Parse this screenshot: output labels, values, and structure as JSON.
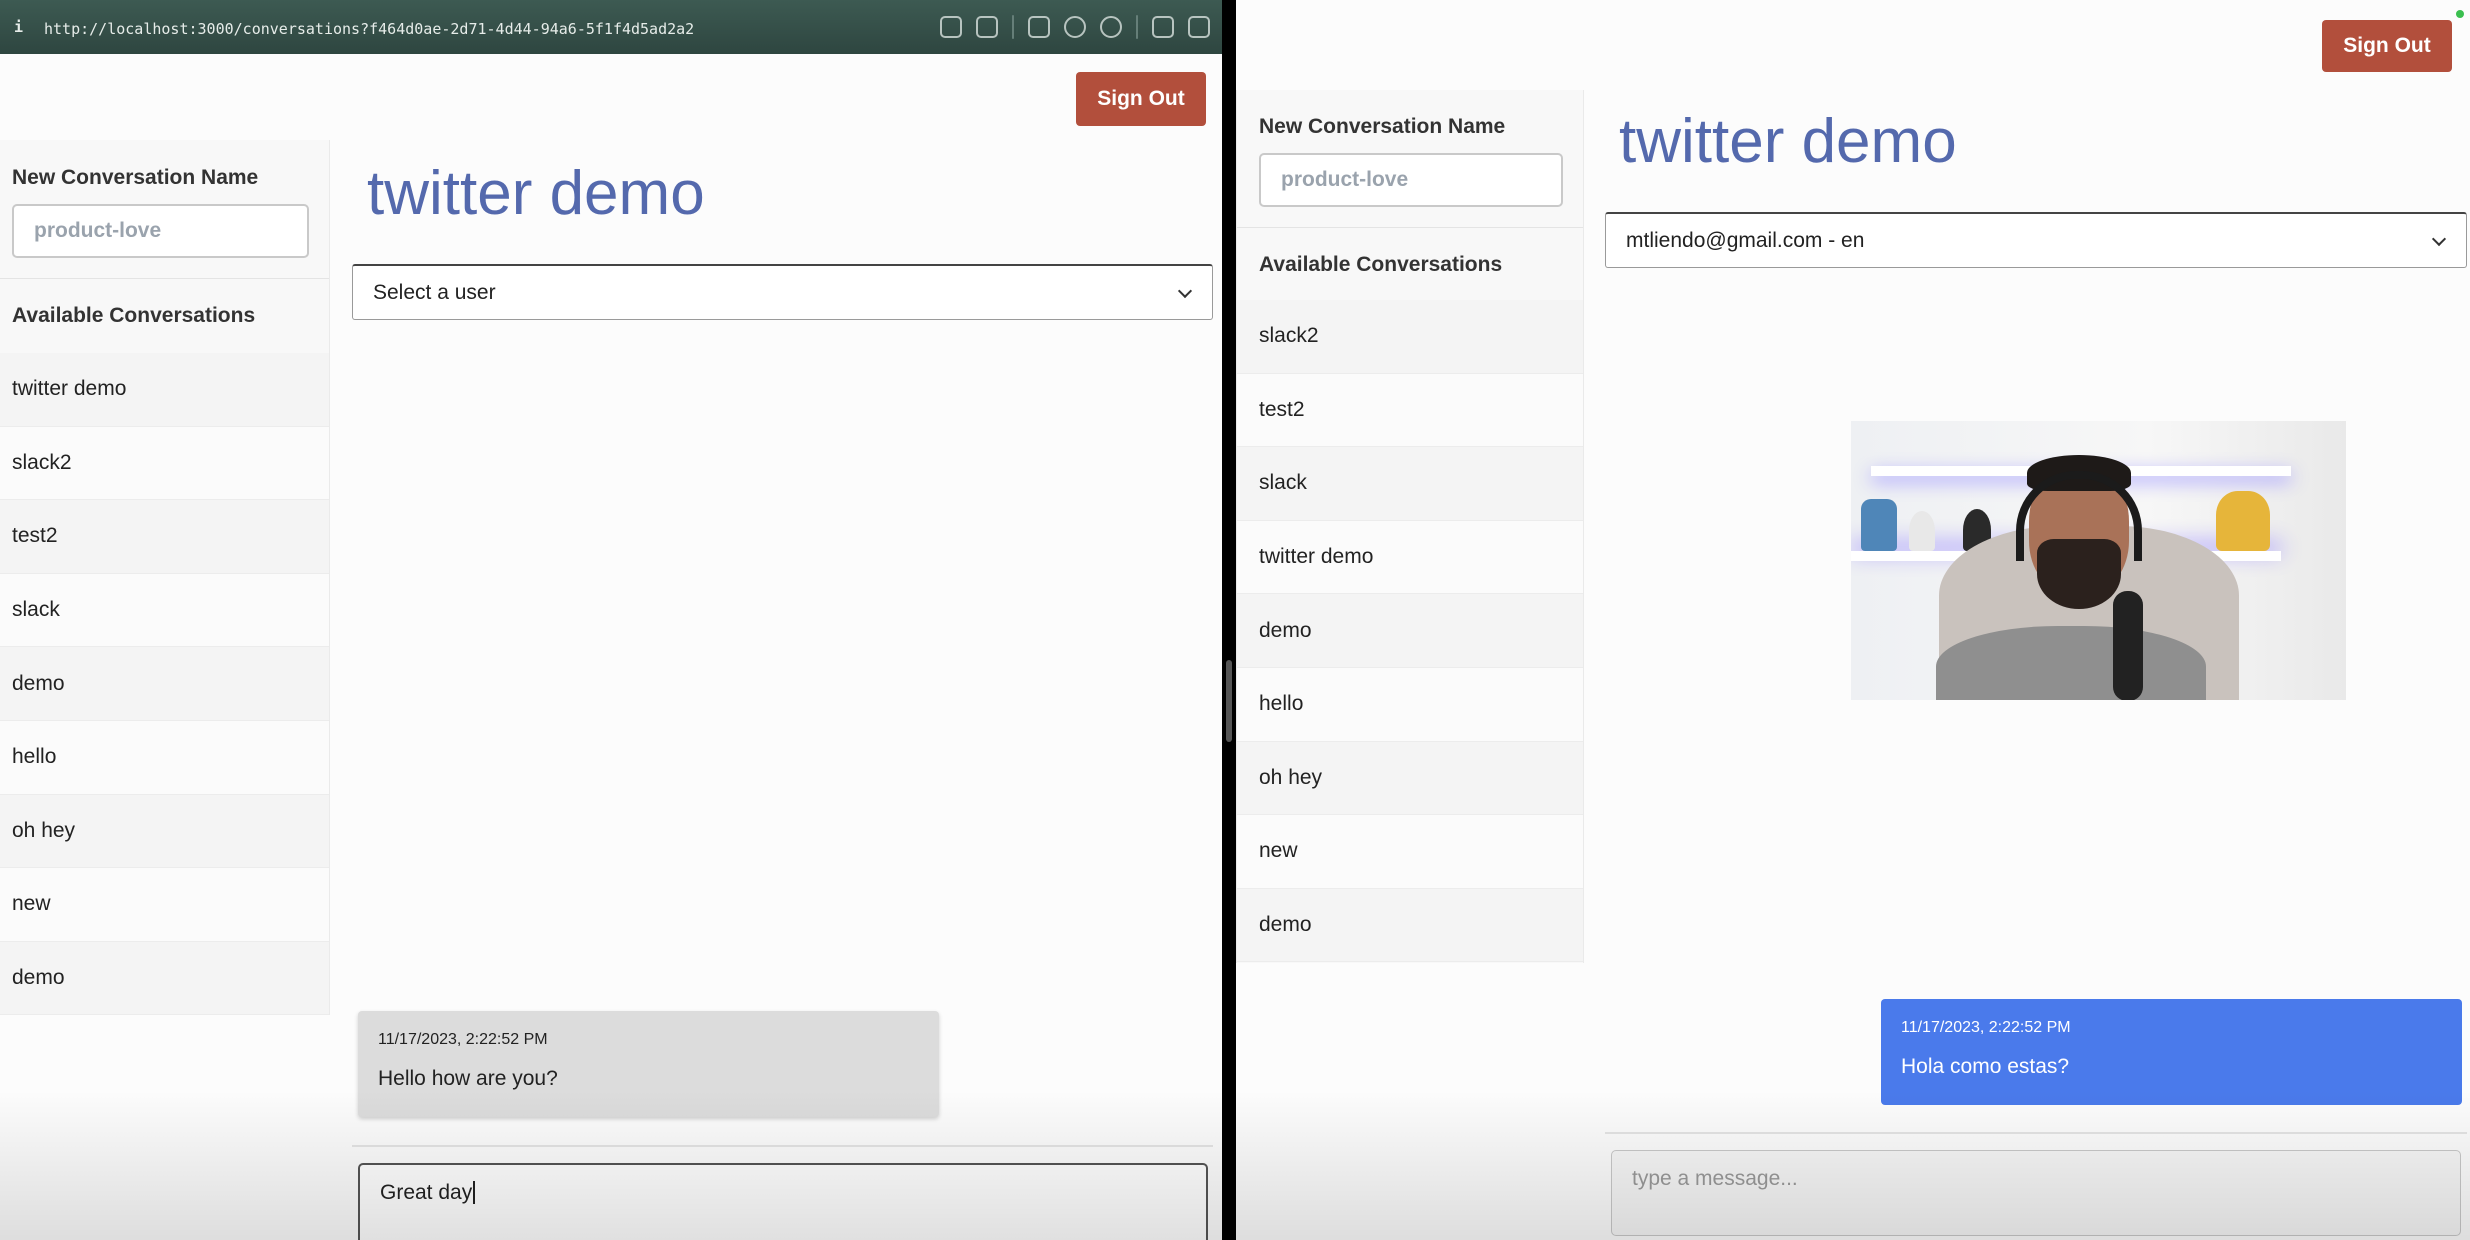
{
  "browser": {
    "info_glyph": "i",
    "url": "http://localhost:3000/conversations?f464d0ae-2d71-4d44-94a6-5f1f4d5ad2a2",
    "tool_icons": [
      "link-icon",
      "camera-icon",
      "terminal-icon",
      "globe-icon",
      "crosshair-icon",
      "extension-icon",
      "split-view-icon"
    ]
  },
  "colors": {
    "accent": "#5469ad",
    "signout": "#b24f3c",
    "outgoing_bubble": "#4a7aeb",
    "incoming_bubble": "#dcdcdc"
  },
  "left": {
    "signout_label": "Sign Out",
    "new_conv_label": "New Conversation Name",
    "new_conv_placeholder": "product-love",
    "available_label": "Available Conversations",
    "conversations": [
      "twitter demo",
      "slack2",
      "test2",
      "slack",
      "demo",
      "hello",
      "oh hey",
      "new",
      "demo"
    ],
    "title": "twitter demo",
    "select_value": "Select a user",
    "message": {
      "timestamp": "11/17/2023, 2:22:52 PM",
      "text": "Hello how are you?"
    },
    "composer_value": "Great day"
  },
  "right": {
    "signout_label": "Sign Out",
    "new_conv_label": "New Conversation Name",
    "new_conv_placeholder": "product-love",
    "available_label": "Available Conversations",
    "conversations": [
      "slack2",
      "test2",
      "slack",
      "twitter demo",
      "demo",
      "hello",
      "oh hey",
      "new",
      "demo"
    ],
    "title": "twitter demo",
    "select_value": "mtliendo@gmail.com - en",
    "message": {
      "timestamp": "11/17/2023, 2:22:52 PM",
      "text": "Hola como estas?"
    },
    "composer_placeholder": "type a message..."
  }
}
